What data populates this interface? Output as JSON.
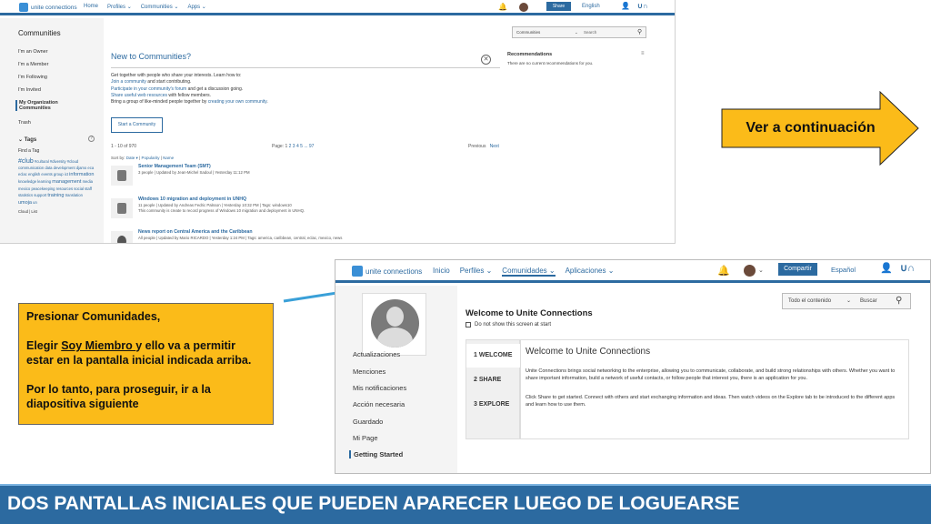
{
  "screen1": {
    "app_name": "unite connections",
    "nav": [
      "Home",
      "Profiles ⌄",
      "Communities ⌄",
      "Apps ⌄"
    ],
    "share_label": "Share",
    "language": "English",
    "sidebar": {
      "title": "Communities",
      "items": [
        "I'm an Owner",
        "I'm a Member",
        "I'm Following",
        "I'm Invited",
        "My Organization Communities",
        "Trash"
      ],
      "tags_header": "⌄ Tags",
      "find_tag": "Find a Tag",
      "tags": [
        "#club",
        "#cultural",
        "#diversity",
        "#cloud",
        "communication",
        "data",
        "development",
        "djamo",
        "eca",
        "eclac",
        "english",
        "events",
        "group",
        "ict",
        "information",
        "knowledge",
        "learning",
        "management",
        "media",
        "mexico",
        "peacekeeping",
        "resources",
        "social",
        "staff",
        "statistics",
        "support",
        "training",
        "translation",
        "umoja",
        "un"
      ],
      "footer_links": "Cloud | List"
    },
    "main": {
      "title": "New to Communities?",
      "intro_line": "Get together with people who share your interests. Learn how to:",
      "link1": "Join a community",
      "rest1": " and start contributing.",
      "link2": "Participate in your community's forum",
      "rest2": " and get a discussion going.",
      "link3": "Share useful web resources",
      "rest3": " with fellow members.",
      "prefix4": "Bring a group of like-minded people together by ",
      "link4": "creating your own community",
      "rest4": ".",
      "start_button": "Start a Community",
      "count": "1 - 10 of 970",
      "page_prefix": "Page: 1",
      "pages": "2  3  4  5 ... 97",
      "prev": "Previous",
      "next": "Next",
      "sort_prefix": "Sort by:",
      "sort_date": "Date ▾",
      "sort_popularity": "Popularity",
      "sort_name": "Name",
      "communities": [
        {
          "title": "Senior Management Team (SMT)",
          "meta": "3 people  |  Updated by Jean-Michel Sadoul  |  Yesterday 11:12 PM",
          "desc": ""
        },
        {
          "title": "Windows 10 migration and deployment in UNHQ",
          "meta": "11 people  |  Updated by Andreas Fedric Palsson  |  Yesterday 10:32 PM  |  Tags: windows10",
          "desc": "This community is create to record progress of Windows 10 migration and deployment in UNHQ."
        },
        {
          "title": "News report on Central America and the Caribbean",
          "meta": "All people  |  Updated by Mario RICARDO  |  Yesterday 1:24 PM  |  Tags: america, caribbean, central, eclac, mexico, news",
          "desc": ""
        }
      ]
    },
    "right": {
      "search_scope": "Communities",
      "search_placeholder": "Search",
      "rec_title": "Recommendations",
      "rec_text": "There are no current recommendations for you."
    }
  },
  "arrow_label": "Ver a continuación",
  "note": {
    "line1": "Presionar Comunidades,",
    "line2_pre": "Elegir ",
    "line2_u": "Soy Miembro ",
    "line2_post": "y ello va a permitir estar en la pantalla inicial indicada arriba.",
    "line3": "Por lo tanto, para proseguir, ir a la diapositiva siguiente"
  },
  "screen2": {
    "app_name": "unite connections",
    "nav": [
      "Inicio",
      "Perfiles ⌄",
      "Comunidades ⌄",
      "Aplicaciones ⌄"
    ],
    "share_label": "Compartir",
    "language": "Español",
    "sidebar": [
      "Actualizaciones",
      "Menciones",
      "Mis notificaciones",
      "Acción necesaria",
      "Guardado",
      "Mi Page",
      "Getting Started"
    ],
    "search_scope": "Todo el contenido",
    "search_placeholder": "Buscar",
    "welcome_title": "Welcome to Unite Connections",
    "dont_show": "Do not show this screen at start",
    "steps": [
      "1  WELCOME",
      "2  SHARE",
      "3  EXPLORE"
    ],
    "panel_title": "Welcome to Unite Connections",
    "panel_text": "Unite Connections brings social networking to the enterprise, allowing you to communicate, collaborate, and build strong relationships with others. Whether you want to share important information, build a network of useful contacts, or follow people that interest you, there is an application for you.",
    "panel_text2": "Click Share to get started. Connect with others and start exchanging information and ideas. Then watch videos on the Explore tab to be introduced to the different apps and learn how to use them."
  },
  "footer_title": "DOS PANTALLAS INICIALES QUE PUEDEN APARECER LUEGO DE LOGUEARSE",
  "colors": {
    "brand_blue": "#2c6aa0",
    "callout_yellow": "#fbbb19",
    "arrow_blue": "#3aa0d8"
  }
}
